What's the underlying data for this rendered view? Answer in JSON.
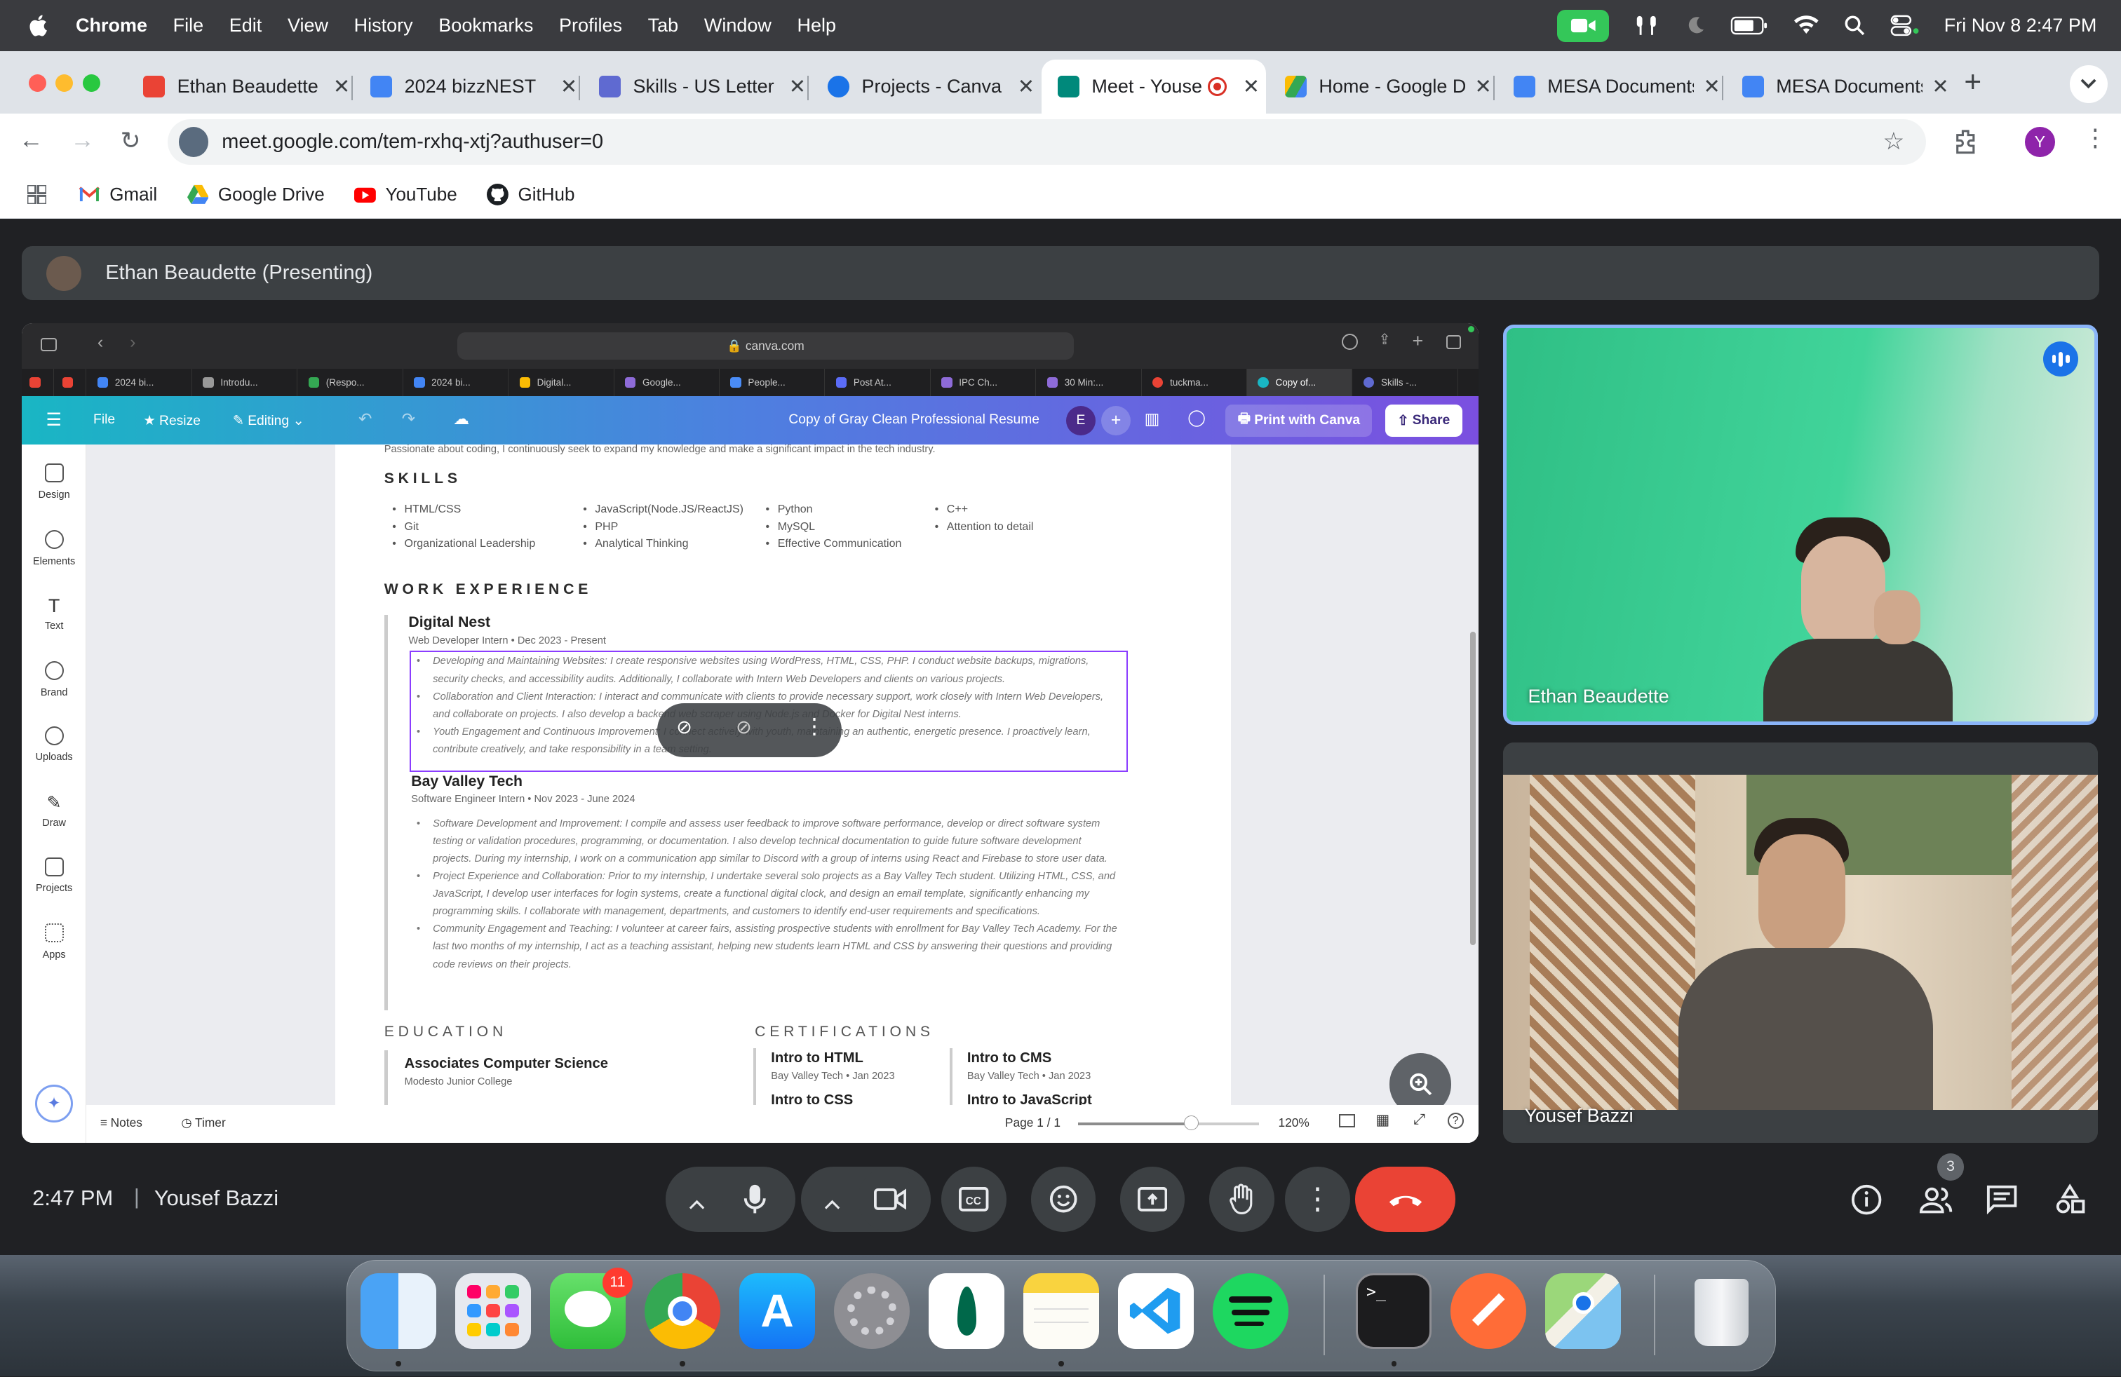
{
  "menubar": {
    "app": "Chrome",
    "items": [
      "File",
      "Edit",
      "View",
      "History",
      "Bookmarks",
      "Profiles",
      "Tab",
      "Window",
      "Help"
    ],
    "datetime": "Fri Nov 8  2:47 PM"
  },
  "tabs": [
    {
      "title": "Ethan Beaudette",
      "color": "#ea4335"
    },
    {
      "title": "2024 bizzNEST",
      "color": "#4285f4"
    },
    {
      "title": "Skills - US Letter",
      "color": "#5f6ad1"
    },
    {
      "title": "Projects - Canva",
      "color": "#1a73e8"
    },
    {
      "title": "Meet - Yousef",
      "color": "#00897b"
    },
    {
      "title": "Home - Google Drive",
      "color": "#fbbc04"
    },
    {
      "title": "MESA Documents",
      "color": "#4285f4"
    },
    {
      "title": "MESA Documents",
      "color": "#4285f4"
    }
  ],
  "toolbar": {
    "url": "meet.google.com/tem-rxhq-xtj?authuser=0",
    "profile_initial": "Y"
  },
  "bookmarks": [
    "Gmail",
    "Google Drive",
    "YouTube",
    "GitHub"
  ],
  "presenting": {
    "label": "Ethan Beaudette (Presenting)"
  },
  "shared_screen": {
    "safari_url": "canva.com",
    "safari_tabs": [
      "2024 bi...",
      "Introdu...",
      "(Respo...",
      "2024 bi...",
      "Digital...",
      "Google...",
      "People...",
      "Post At...",
      "IPC Ch...",
      "30 Min:...",
      "tuckma...",
      "Copy of...",
      "Skills -..."
    ],
    "canva": {
      "file": "File",
      "resize": "Resize",
      "editing": "Editing",
      "doc_title": "Copy of Gray Clean Professional Resume",
      "avatar": "E",
      "print": "Print with Canva",
      "share": "Share",
      "side": [
        "Design",
        "Elements",
        "Text",
        "Brand",
        "Uploads",
        "Draw",
        "Projects",
        "Apps"
      ],
      "notes": "Notes",
      "timer": "Timer",
      "page": "Page 1 / 1",
      "zoom": "120%",
      "zoom_fraction": 0.62
    },
    "resume": {
      "intro": "Passionate about coding, I continuously seek to expand my knowledge and make a significant impact in the tech industry.",
      "skills_heading": "SKILLS",
      "skills_col1": [
        "HTML/CSS",
        "Git",
        "Organizational Leadership"
      ],
      "skills_col2": [
        "JavaScript(Node.JS/ReactJS)",
        "PHP",
        "Analytical Thinking"
      ],
      "skills_col3": [
        "Python",
        "MySQL",
        "Effective Communication"
      ],
      "skills_col4": [
        "C++",
        "Attention to detail"
      ],
      "work_heading": "WORK EXPERIENCE",
      "job1_title": "Digital Nest",
      "job1_sub": "Web Developer Intern • Dec 2023 - Present",
      "job1_bullets": [
        "Developing and Maintaining Websites: I create responsive websites using WordPress, HTML, CSS, PHP. I conduct website backups, migrations, security checks, and accessibility audits. Additionally, I collaborate with Intern Web Developers and clients on various projects.",
        "Collaboration and Client Interaction: I interact and communicate with clients to provide necessary support, work closely with Intern Web Developers, and collaborate on projects. I also develop a backend web scraper using Node.js and Docker for Digital Nest interns.",
        "Youth Engagement and Continuous Improvement: I connect actively with youth, maintaining an authentic, energetic presence. I proactively learn, contribute creatively, and take responsibility in a team setting."
      ],
      "job2_title": "Bay Valley Tech",
      "job2_sub": "Software Engineer Intern • Nov 2023 - June 2024",
      "job2_bullets": [
        "Software Development and Improvement: I compile and assess user feedback to improve software performance, develop or direct software system testing or validation procedures, programming, or documentation. I also develop technical documentation to guide future software development projects. During my internship, I work on a communication app similar to Discord with a group of interns using React and Firebase to store user data.",
        "Project Experience and Collaboration: Prior to my internship, I undertake several solo projects as a Bay Valley Tech student. Utilizing HTML, CSS, and JavaScript, I develop user interfaces for login systems, create a functional digital clock, and design an email template, significantly enhancing my programming skills. I collaborate with management, departments, and customers to identify end-user requirements and specifications.",
        "Community Engagement and Teaching: I volunteer at career fairs, assisting prospective students with enrollment for Bay Valley Tech Academy. For the last two months of my internship, I act as a teaching assistant, helping new students learn HTML and CSS by answering their questions and providing code reviews on their projects."
      ],
      "education_heading": "EDUCATION",
      "edu_title": "Associates Computer Science",
      "edu_sub": "Modesto Junior College",
      "cert_heading": "CERTIFICATIONS",
      "certs": [
        {
          "title": "Intro to HTML",
          "sub": "Bay Valley Tech • Jan 2023"
        },
        {
          "title": "Intro to CMS",
          "sub": "Bay Valley Tech • Jan 2023"
        },
        {
          "title": "Intro to CSS",
          "sub": ""
        },
        {
          "title": "Intro to JavaScript",
          "sub": ""
        }
      ]
    }
  },
  "participants": [
    {
      "name": "Ethan Beaudette",
      "speaking": true
    },
    {
      "name": "Yousef Bazzi",
      "speaking": false
    }
  ],
  "bottom_bar": {
    "time": "2:47 PM",
    "separator": "|",
    "meeting_name": "Yousef Bazzi",
    "people_count": "3"
  },
  "dock": {
    "apps": [
      "Finder",
      "Launchpad",
      "Messages",
      "Chrome",
      "App Store",
      "System Settings",
      "MongoDB Compass",
      "Notes",
      "Visual Studio Code",
      "Spotify",
      "Terminal",
      "Postman",
      "Maps",
      "Trash"
    ],
    "messages_badge": "11"
  },
  "colors": {
    "meet_bg": "#202124",
    "end_call": "#ea4335",
    "active_speaker": "#8ab4f8",
    "canva_purple": "#7d2ae8"
  }
}
